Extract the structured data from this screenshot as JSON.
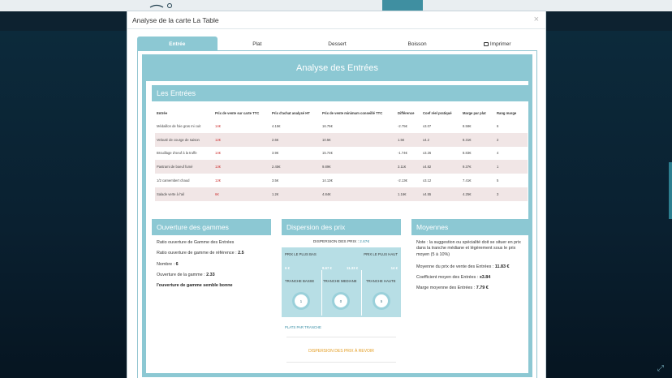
{
  "modal": {
    "title": "Analyse de la carte La Table",
    "close": "×"
  },
  "tabs": [
    {
      "label": "Entrée",
      "active": true
    },
    {
      "label": "Plat"
    },
    {
      "label": "Dessert"
    },
    {
      "label": "Boisson"
    },
    {
      "label": "Imprimer",
      "icon": "printer-icon"
    }
  ],
  "main_title": "Analyse des Entrées",
  "entrees": {
    "title": "Les Entrées",
    "columns": [
      "Entrée",
      "Prix de vente sur carte TTC",
      "Prix d'achat analysé HT",
      "Prix de vente minimum conseillé TTC",
      "Différence",
      "Coef réel pratiqué",
      "Marge par plat",
      "Rang marge"
    ],
    "rows": [
      [
        "Médaillon de foie gras mi cuit",
        "14€",
        "4.15€",
        "16.75€",
        "-2.75€",
        "x3.07",
        "8.58€",
        "6"
      ],
      [
        "Velouté de courge de saison",
        "12€",
        "2.6€",
        "10.5€",
        "1.5€",
        "x4.2",
        "8.31€",
        "2"
      ],
      [
        "Brouillage d'oeuf à la truffe",
        "14€",
        "3.9€",
        "15.74€",
        "-1.74€",
        "x3.26",
        "8.83€",
        "4"
      ],
      [
        "Pastrami de boeuf fumé",
        "13€",
        "2.45€",
        "9.89€",
        "3.11€",
        "x4.82",
        "9.37€",
        "1"
      ],
      [
        "1/2 camembert chaud",
        "12€",
        "3.5€",
        "14.13€",
        "-2.13€",
        "x3.12",
        "7.41€",
        "5"
      ],
      [
        "Salade verte à l'ail",
        "6€",
        "1.2€",
        "4.84€",
        "1.16€",
        "x4.55",
        "4.25€",
        "3"
      ]
    ]
  },
  "gammes": {
    "title": "Ouverture des gammes",
    "ratio_label": "Ratio ouverture de Gamme des Entrées",
    "ratio_ref_label": "Ratio ouverture de gamme de référence : ",
    "ratio_ref_value": "2.5",
    "nombre_label": "Nombre : ",
    "nombre_value": "6",
    "ouverture_label": "Ouverture de la gamme : ",
    "ouverture_value": "2.33",
    "verdict": "l'ouverture de gamme semble bonne"
  },
  "dispersion": {
    "title": "Dispersion des prix",
    "header_label": "DISPERSION DES PRIX : ",
    "header_value": "2.67€",
    "low_label": "PRIX LE PLUS BAS",
    "high_label": "PRIX LE PLUS HAUT",
    "v1": "6 €",
    "v2": "8.67 €",
    "v3": "11.33 €",
    "v4": "14 €",
    "tranche_basse": "TRANCHE BASSE",
    "tranche_mediane": "TRANCHE MEDIANE",
    "tranche_haute": "TRANCHE HAUTE",
    "count_basse": "1",
    "count_mediane": "0",
    "count_haute": "5",
    "foot_link": "PLATS PAR TRANCHE",
    "foot_warning": "DISPERSION DES PRIX À REVOIR"
  },
  "moyennes": {
    "title": "Moyennes",
    "note": "Note : la suggestion ou spécialité doit se situer en prix dans la tranche médiane et légèrement sous le prix moyen (5 à 10%)",
    "prix_moyen_label": "Moyenne du prix de vente des Entrées : ",
    "prix_moyen_value": "11.83 €",
    "coef_label": "Coefficient moyen des Entrées : ",
    "coef_value": "x3.84",
    "marge_label": "Marge moyenne des Entrées : ",
    "marge_value": "7.79 €"
  },
  "colors": {
    "accent": "#8cc8d3",
    "warning": "#e39b1d",
    "negative": "#cc3333"
  }
}
